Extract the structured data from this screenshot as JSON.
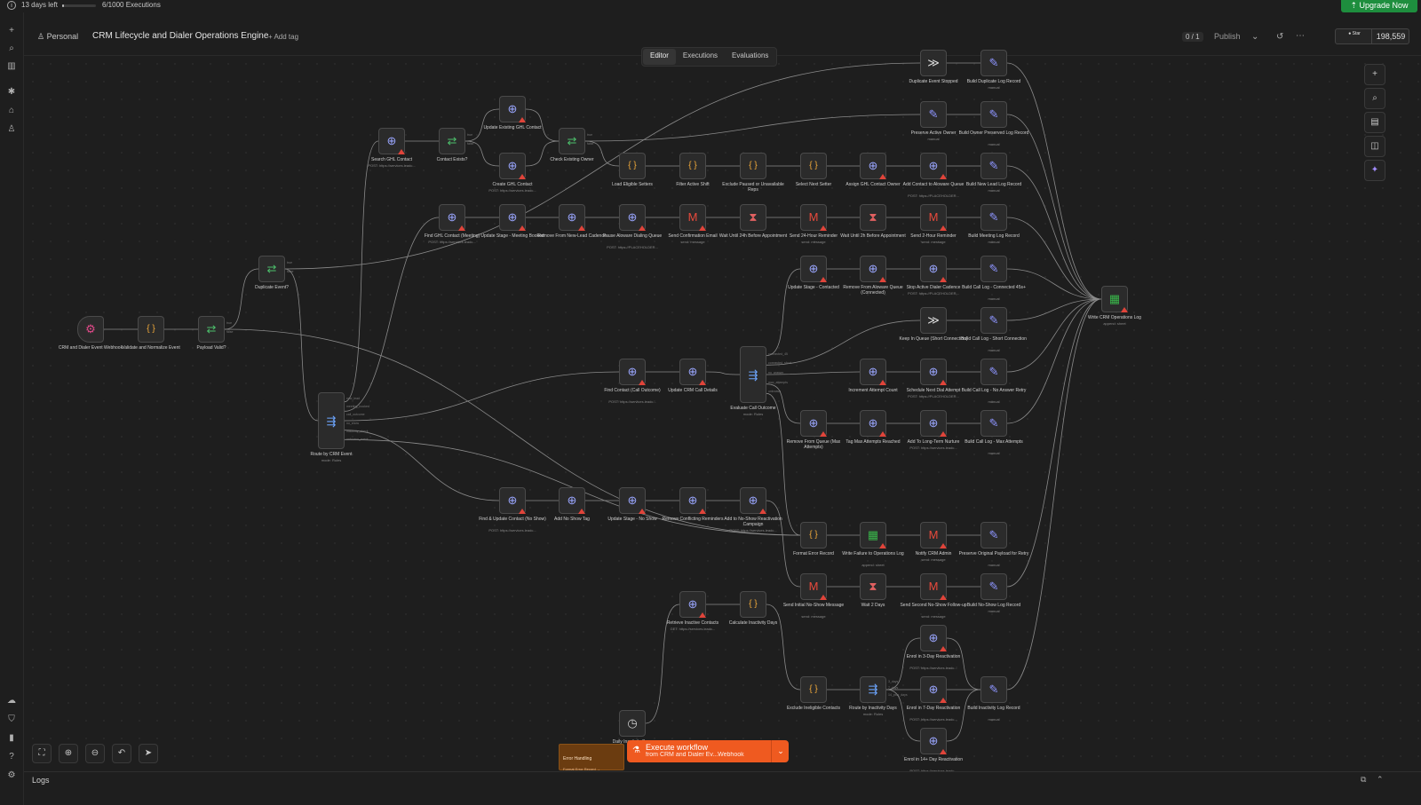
{
  "trial": {
    "days_left": "13 days left",
    "executions": "6/1000 Executions",
    "usage_fraction": 0.006,
    "upgrade": "Upgrade Now"
  },
  "header": {
    "project": "Personal",
    "workflow_title": "CRM Lifecycle and Dialer Operations Engine",
    "add_tag": "+ Add tag",
    "publish_count": "0 / 1",
    "publish": "Publish",
    "star_label": "Star",
    "star_count": "198,559"
  },
  "tabs": [
    {
      "label": "Editor",
      "active": true
    },
    {
      "label": "Executions",
      "active": false
    },
    {
      "label": "Evaluations",
      "active": false
    }
  ],
  "nodes": [
    {
      "id": "n1",
      "type": "webhook",
      "icon": "webhook-icon",
      "glyph": "⚙",
      "label": "CRM and Dialer Event Webhook"
    },
    {
      "id": "n2",
      "type": "code",
      "icon": "code-braces-icon",
      "glyph": "{ }",
      "label": "Validate and Normalize Event"
    },
    {
      "id": "n3",
      "type": "if",
      "icon": "branch-icon",
      "glyph": "⇄",
      "label": "Payload Valid?"
    },
    {
      "id": "n4",
      "type": "if",
      "icon": "branch-icon",
      "glyph": "⇄",
      "label": "Duplicate Event?"
    },
    {
      "id": "n5",
      "type": "switch",
      "icon": "switch-icon",
      "glyph": "⇶",
      "label": "Route by CRM Event",
      "sub": "mode: Rules",
      "tall": true
    },
    {
      "id": "n6",
      "type": "http",
      "icon": "globe-icon",
      "glyph": "⊕",
      "label": "Search GHL Contact",
      "sub": "POST: https://services.leadc...",
      "warn": true
    },
    {
      "id": "n7",
      "type": "if",
      "icon": "branch-icon",
      "glyph": "⇄",
      "label": "Contact Exists?"
    },
    {
      "id": "n8",
      "type": "http",
      "icon": "globe-icon",
      "glyph": "⊕",
      "label": "Update Existing GHL Contact",
      "warn": true
    },
    {
      "id": "n9",
      "type": "http",
      "icon": "globe-icon",
      "glyph": "⊕",
      "label": "Create GHL Contact",
      "sub": "POST: https://services.leadc...",
      "warn": true
    },
    {
      "id": "n10",
      "type": "if",
      "icon": "branch-icon",
      "glyph": "⇄",
      "label": "Check Existing Owner"
    },
    {
      "id": "n11",
      "type": "code",
      "icon": "code-braces-icon",
      "glyph": "{ }",
      "label": "Load Eligible Setters"
    },
    {
      "id": "n12",
      "type": "code",
      "icon": "code-braces-icon",
      "glyph": "{ }",
      "label": "Filter Active Shift"
    },
    {
      "id": "n13",
      "type": "code",
      "icon": "code-braces-icon",
      "glyph": "{ }",
      "label": "Exclude Paused or Unavailable Reps"
    },
    {
      "id": "n14",
      "type": "code",
      "icon": "code-braces-icon",
      "glyph": "{ }",
      "label": "Select Next Setter"
    },
    {
      "id": "n15",
      "type": "http",
      "icon": "globe-icon",
      "glyph": "⊕",
      "label": "Assign GHL Contact Owner",
      "warn": true
    },
    {
      "id": "n16",
      "type": "http",
      "icon": "globe-icon",
      "glyph": "⊕",
      "label": "Add Contact to Aloware Queue",
      "sub": "POST: https://PLACEHOLDER...",
      "warn": true
    },
    {
      "id": "n17",
      "type": "set",
      "icon": "pencil-icon",
      "glyph": "✎",
      "label": "Build New Lead Log Record",
      "sub": "manual"
    },
    {
      "id": "n18",
      "type": "nop",
      "icon": "double-chevron-icon",
      "glyph": "≫",
      "label": "Duplicate Event Stopped"
    },
    {
      "id": "n19",
      "type": "set",
      "icon": "pencil-icon",
      "glyph": "✎",
      "label": "Build Duplicate Log Record",
      "sub": "manual"
    },
    {
      "id": "n20",
      "type": "set",
      "icon": "pencil-icon",
      "glyph": "✎",
      "label": "Preserve Active Owner",
      "sub": "manual"
    },
    {
      "id": "n21",
      "type": "set",
      "icon": "pencil-icon",
      "glyph": "✎",
      "label": "Build Owner Preserved Log Record",
      "sub": "manual"
    },
    {
      "id": "n22",
      "type": "http",
      "icon": "globe-icon",
      "glyph": "⊕",
      "label": "Find GHL Contact (Meeting)",
      "sub": "POST: https://services.leadc...",
      "warn": true
    },
    {
      "id": "n23",
      "type": "http",
      "icon": "globe-icon",
      "glyph": "⊕",
      "label": "Update Stage - Meeting Booked",
      "warn": true
    },
    {
      "id": "n24",
      "type": "http",
      "icon": "globe-icon",
      "glyph": "⊕",
      "label": "Remove From New-Lead Cadence",
      "warn": true
    },
    {
      "id": "n25",
      "type": "http",
      "icon": "globe-icon",
      "glyph": "⊕",
      "label": "Pause Aloware Dialing Queue",
      "sub": "POST: https://PLACEHOLDER...",
      "warn": true
    },
    {
      "id": "n26",
      "type": "gmail",
      "icon": "gmail-icon",
      "glyph": "M",
      "label": "Send Confirmation Email",
      "sub": "send: message",
      "warn": true
    },
    {
      "id": "n27",
      "type": "wait",
      "icon": "hourglass-icon",
      "glyph": "⧗",
      "label": "Wait Until 24h Before Appointment"
    },
    {
      "id": "n28",
      "type": "gmail",
      "icon": "gmail-icon",
      "glyph": "M",
      "label": "Send 24-Hour Reminder",
      "sub": "send: message",
      "warn": true
    },
    {
      "id": "n29",
      "type": "wait",
      "icon": "hourglass-icon",
      "glyph": "⧗",
      "label": "Wait Until 2h Before Appointment"
    },
    {
      "id": "n30",
      "type": "gmail",
      "icon": "gmail-icon",
      "glyph": "M",
      "label": "Send 2-Hour Reminder",
      "sub": "send: message",
      "warn": true
    },
    {
      "id": "n31",
      "type": "set",
      "icon": "pencil-icon",
      "glyph": "✎",
      "label": "Build Meeting Log Record",
      "sub": "manual"
    },
    {
      "id": "n32",
      "type": "http",
      "icon": "globe-icon",
      "glyph": "⊕",
      "label": "Update Stage - Contacted",
      "warn": true
    },
    {
      "id": "n33",
      "type": "http",
      "icon": "globe-icon",
      "glyph": "⊕",
      "label": "Remove From Aloware Queue (Connected)",
      "warn": true
    },
    {
      "id": "n34",
      "type": "http",
      "icon": "globe-icon",
      "glyph": "⊕",
      "label": "Stop Active Dialer Cadence",
      "sub": "POST: https://PLACEHOLDER...",
      "warn": true
    },
    {
      "id": "n35",
      "type": "set",
      "icon": "pencil-icon",
      "glyph": "✎",
      "label": "Build Call Log - Connected 45s+",
      "sub": "manual"
    },
    {
      "id": "n36",
      "type": "nop",
      "icon": "double-chevron-icon",
      "glyph": "≫",
      "label": "Keep In Queue (Short Connection)"
    },
    {
      "id": "n37",
      "type": "set",
      "icon": "pencil-icon",
      "glyph": "✎",
      "label": "Build Call Log - Short Connection",
      "sub": "manual"
    },
    {
      "id": "n38",
      "type": "sheet",
      "icon": "sheets-icon",
      "glyph": "▦",
      "label": "Write CRM Operations Log",
      "sub": "append: sheet",
      "warn": true
    },
    {
      "id": "n39",
      "type": "http",
      "icon": "globe-icon",
      "glyph": "⊕",
      "label": "Find Contact (Call Outcome)",
      "sub": "POST: https://services.leadc...",
      "warn": true
    },
    {
      "id": "n40",
      "type": "http",
      "icon": "globe-icon",
      "glyph": "⊕",
      "label": "Update CRM Call Details",
      "warn": true
    },
    {
      "id": "n41",
      "type": "switch",
      "icon": "switch-icon",
      "glyph": "⇶",
      "label": "Evaluate Call Outcome",
      "sub": "mode: Rules",
      "tall": true
    },
    {
      "id": "n42",
      "type": "http",
      "icon": "globe-icon",
      "glyph": "⊕",
      "label": "Increment Attempt Count",
      "warn": true
    },
    {
      "id": "n43",
      "type": "http",
      "icon": "globe-icon",
      "glyph": "⊕",
      "label": "Schedule Next Dial Attempt",
      "sub": "POST: https://PLACEHOLDER...",
      "warn": true
    },
    {
      "id": "n44",
      "type": "set",
      "icon": "pencil-icon",
      "glyph": "✎",
      "label": "Build Call Log - No Answer Retry",
      "sub": "manual"
    },
    {
      "id": "n45",
      "type": "http",
      "icon": "globe-icon",
      "glyph": "⊕",
      "label": "Remove From Queue (Max Attempts)",
      "warn": true
    },
    {
      "id": "n46",
      "type": "http",
      "icon": "globe-icon",
      "glyph": "⊕",
      "label": "Tag Max Attempts Reached",
      "warn": true
    },
    {
      "id": "n47",
      "type": "http",
      "icon": "globe-icon",
      "glyph": "⊕",
      "label": "Add To Long-Term Nurture",
      "sub": "POST: https://services.leadc...",
      "warn": true
    },
    {
      "id": "n48",
      "type": "set",
      "icon": "pencil-icon",
      "glyph": "✎",
      "label": "Build Call Log - Max Attempts",
      "sub": "manual"
    },
    {
      "id": "n49",
      "type": "http",
      "icon": "globe-icon",
      "glyph": "⊕",
      "label": "Find & Update Contact (No Show)",
      "sub": "POST: https://services.leadc...",
      "warn": true
    },
    {
      "id": "n50",
      "type": "http",
      "icon": "globe-icon",
      "glyph": "⊕",
      "label": "Add No Show Tag",
      "warn": true
    },
    {
      "id": "n51",
      "type": "http",
      "icon": "globe-icon",
      "glyph": "⊕",
      "label": "Update Stage - No Show",
      "warn": true
    },
    {
      "id": "n52",
      "type": "http",
      "icon": "globe-icon",
      "glyph": "⊕",
      "label": "Remove Conflicting Reminders",
      "warn": true
    },
    {
      "id": "n53",
      "type": "http",
      "icon": "globe-icon",
      "glyph": "⊕",
      "label": "Add to No-Show Reactivation Campaign",
      "sub": "POST: https://services.leadc...",
      "warn": true
    },
    {
      "id": "n54",
      "type": "code",
      "icon": "code-braces-icon",
      "glyph": "{ }",
      "label": "Format Error Record"
    },
    {
      "id": "n55",
      "type": "sheet",
      "icon": "sheets-icon",
      "glyph": "▦",
      "label": "Write Failure to Operations Log",
      "sub": "append: sheet",
      "warn": true
    },
    {
      "id": "n56",
      "type": "gmail",
      "icon": "gmail-icon",
      "glyph": "M",
      "label": "Notify CRM Admin",
      "sub": "send: message",
      "warn": true
    },
    {
      "id": "n57",
      "type": "set",
      "icon": "pencil-icon",
      "glyph": "✎",
      "label": "Preserve Original Payload for Retry",
      "sub": "manual"
    },
    {
      "id": "n58",
      "type": "gmail",
      "icon": "gmail-icon",
      "glyph": "M",
      "label": "Send Initial No-Show Message",
      "sub": "send: message",
      "warn": true
    },
    {
      "id": "n59",
      "type": "wait",
      "icon": "hourglass-icon",
      "glyph": "⧗",
      "label": "Wait 2 Days"
    },
    {
      "id": "n60",
      "type": "gmail",
      "icon": "gmail-icon",
      "glyph": "M",
      "label": "Send Second No-Show Follow-up",
      "sub": "send: message",
      "warn": true
    },
    {
      "id": "n61",
      "type": "set",
      "icon": "pencil-icon",
      "glyph": "✎",
      "label": "Build No-Show Log Record",
      "sub": "manual"
    },
    {
      "id": "n62",
      "type": "http",
      "icon": "globe-icon",
      "glyph": "⊕",
      "label": "Retrieve Inactive Contacts",
      "sub": "GET: https://services.leadc...",
      "warn": true
    },
    {
      "id": "n63",
      "type": "code",
      "icon": "code-braces-icon",
      "glyph": "{ }",
      "label": "Calculate Inactivity Days"
    },
    {
      "id": "n64",
      "type": "code",
      "icon": "code-braces-icon",
      "glyph": "{ }",
      "label": "Exclude Ineligible Contacts"
    },
    {
      "id": "n65",
      "type": "switch",
      "icon": "switch-icon",
      "glyph": "⇶",
      "label": "Route by Inactivity Days",
      "sub": "mode: Rules"
    },
    {
      "id": "n66",
      "type": "http",
      "icon": "globe-icon",
      "glyph": "⊕",
      "label": "Enrol in 3-Day Reactivation",
      "sub": "POST: https://services.leadc...",
      "warn": true
    },
    {
      "id": "n67",
      "type": "http",
      "icon": "globe-icon",
      "glyph": "⊕",
      "label": "Enrol in 7-Day Reactivation",
      "sub": "POST: https://services.leadc...",
      "warn": true
    },
    {
      "id": "n68",
      "type": "http",
      "icon": "globe-icon",
      "glyph": "⊕",
      "label": "Enrol in 14+ Day Reactivation",
      "sub": "POST: https://services.leadc...",
      "warn": true
    },
    {
      "id": "n69",
      "type": "set",
      "icon": "pencil-icon",
      "glyph": "✎",
      "label": "Build Inactivity Log Record",
      "sub": "manual"
    },
    {
      "id": "n70",
      "type": "schedule",
      "icon": "clock-icon",
      "glyph": "◷",
      "label": "Daily Inactivity Scan"
    }
  ],
  "edges": [
    [
      "n1",
      "n2"
    ],
    [
      "n2",
      "n3"
    ],
    [
      "n3",
      "n4"
    ],
    [
      "n3",
      "n54"
    ],
    [
      "n4",
      "n18"
    ],
    [
      "n4",
      "n5"
    ],
    [
      "n5",
      "n6"
    ],
    [
      "n5",
      "n22"
    ],
    [
      "n5",
      "n39"
    ],
    [
      "n5",
      "n49"
    ],
    [
      "n5",
      "n54"
    ],
    [
      "n6",
      "n7"
    ],
    [
      "n7",
      "n8"
    ],
    [
      "n7",
      "n9"
    ],
    [
      "n8",
      "n10"
    ],
    [
      "n9",
      "n10"
    ],
    [
      "n10",
      "n20"
    ],
    [
      "n10",
      "n11"
    ],
    [
      "n11",
      "n12"
    ],
    [
      "n12",
      "n13"
    ],
    [
      "n13",
      "n14"
    ],
    [
      "n14",
      "n15"
    ],
    [
      "n15",
      "n16"
    ],
    [
      "n16",
      "n17"
    ],
    [
      "n18",
      "n19"
    ],
    [
      "n20",
      "n21"
    ],
    [
      "n22",
      "n23"
    ],
    [
      "n23",
      "n24"
    ],
    [
      "n24",
      "n25"
    ],
    [
      "n25",
      "n26"
    ],
    [
      "n26",
      "n27"
    ],
    [
      "n27",
      "n28"
    ],
    [
      "n28",
      "n29"
    ],
    [
      "n29",
      "n30"
    ],
    [
      "n30",
      "n31"
    ],
    [
      "n32",
      "n33"
    ],
    [
      "n33",
      "n34"
    ],
    [
      "n34",
      "n35"
    ],
    [
      "n36",
      "n37"
    ],
    [
      "n39",
      "n40"
    ],
    [
      "n40",
      "n41"
    ],
    [
      "n41",
      "n32"
    ],
    [
      "n41",
      "n36"
    ],
    [
      "n41",
      "n42"
    ],
    [
      "n41",
      "n45"
    ],
    [
      "n41",
      "n54"
    ],
    [
      "n42",
      "n43"
    ],
    [
      "n43",
      "n44"
    ],
    [
      "n45",
      "n46"
    ],
    [
      "n46",
      "n47"
    ],
    [
      "n47",
      "n48"
    ],
    [
      "n49",
      "n50"
    ],
    [
      "n50",
      "n51"
    ],
    [
      "n51",
      "n52"
    ],
    [
      "n52",
      "n53"
    ],
    [
      "n53",
      "n58"
    ],
    [
      "n54",
      "n55"
    ],
    [
      "n55",
      "n56"
    ],
    [
      "n56",
      "n57"
    ],
    [
      "n58",
      "n59"
    ],
    [
      "n59",
      "n60"
    ],
    [
      "n60",
      "n61"
    ],
    [
      "n70",
      "n62"
    ],
    [
      "n62",
      "n63"
    ],
    [
      "n63",
      "n64"
    ],
    [
      "n64",
      "n65"
    ],
    [
      "n65",
      "n66"
    ],
    [
      "n65",
      "n67"
    ],
    [
      "n65",
      "n68"
    ],
    [
      "n66",
      "n69"
    ],
    [
      "n67",
      "n69"
    ],
    [
      "n68",
      "n69"
    ],
    [
      "n17",
      "n38"
    ],
    [
      "n19",
      "n38"
    ],
    [
      "n21",
      "n38"
    ],
    [
      "n31",
      "n38"
    ],
    [
      "n35",
      "n38"
    ],
    [
      "n37",
      "n38"
    ],
    [
      "n44",
      "n38"
    ],
    [
      "n48",
      "n38"
    ],
    [
      "n61",
      "n38"
    ],
    [
      "n69",
      "n38"
    ]
  ],
  "branch_labels": {
    "n3": [
      "true",
      "false"
    ],
    "n4": [
      "true",
      "false"
    ],
    "n7": [
      "true",
      "false"
    ],
    "n10": [
      "true",
      "false"
    ],
    "n5": [
      "new_lead",
      "meeting_booked",
      "call_outcome",
      "no_show",
      "inactivity_check",
      "unknown_event"
    ],
    "n41": [
      "connected_45",
      "connected_short",
      "no_answer",
      "max_attempts",
      "unknown"
    ],
    "n65": [
      "3_days",
      "7_days",
      "14_plus_days"
    ]
  },
  "colors": {
    "http": "#9aa6ff",
    "code": "#f0a93a",
    "if": "#4cbf6b",
    "wait": "#e06060",
    "gmail": "#e84a3c",
    "set": "#8e95ff",
    "nop": "#dddddd",
    "sheet": "#39b54a",
    "switch": "#6da6ff",
    "webhook": "#e24a8a",
    "schedule": "#cfcfcf",
    "accent": "#ef5a20",
    "upgrade": "#1e8e3e"
  },
  "controls": {
    "fit_icon": "fit-view-icon",
    "zoom_in_icon": "zoom-in-icon",
    "zoom_out_icon": "zoom-out-icon",
    "undo_icon": "undo-icon",
    "select_icon": "cursor-icon"
  },
  "execute": {
    "label": "Execute workflow",
    "sub": "from CRM and Dialer Ev...Webhook"
  },
  "sticky": {
    "title": "Error Handling",
    "body": "Format Error Record →"
  },
  "logs": {
    "label": "Logs"
  }
}
